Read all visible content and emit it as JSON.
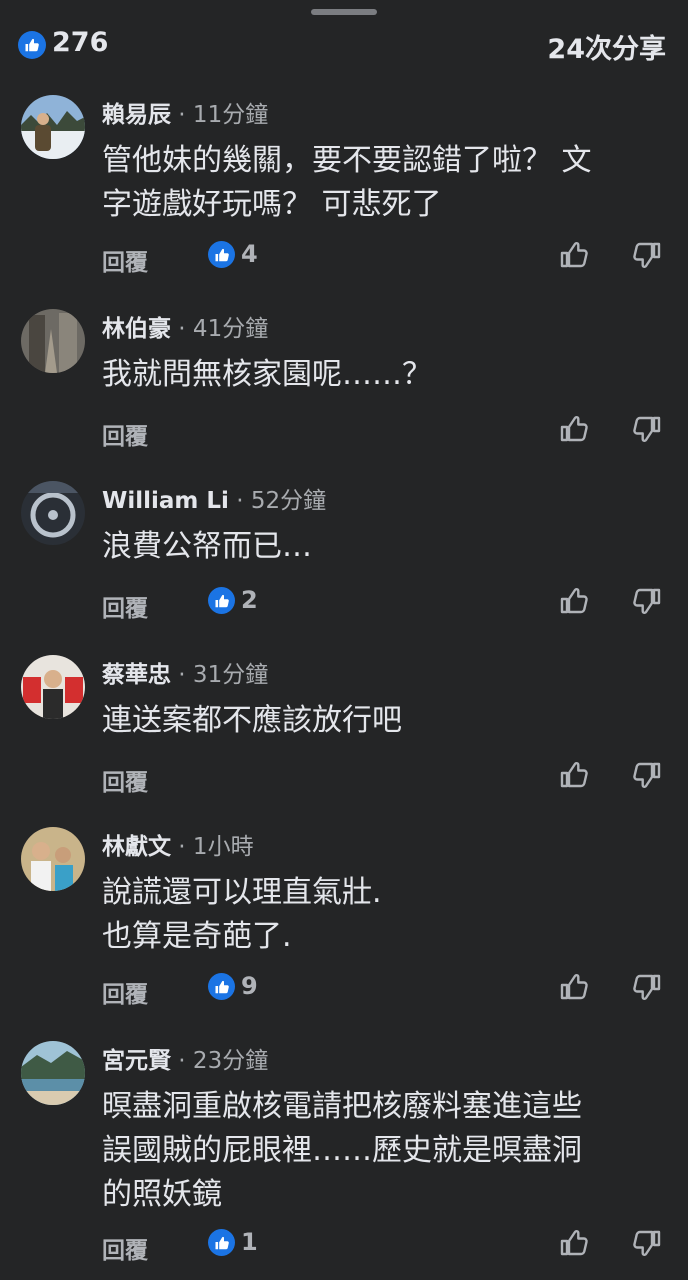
{
  "header": {
    "like_count": "276",
    "shares": "24次分享"
  },
  "reply_label": "回覆",
  "comments": [
    {
      "name": "賴易辰",
      "time": " · 11分鐘",
      "text": "管他妹的幾關，要不要認錯了啦？ 文\n字遊戲好玩嗎？ 可悲死了",
      "likes": "4"
    },
    {
      "name": "林伯豪",
      "time": " · 41分鐘",
      "text": "我就問無核家園呢……？",
      "likes": ""
    },
    {
      "name": "William Li",
      "time": " · 52分鐘",
      "text": "浪費公帑而已…",
      "likes": "2"
    },
    {
      "name": "蔡華忠",
      "time": " · 31分鐘",
      "text": "連送案都不應該放行吧",
      "likes": ""
    },
    {
      "name": "林獻文",
      "time": " · 1小時",
      "text": "說謊還可以理直氣壯.\n也算是奇葩了.",
      "likes": "9"
    },
    {
      "name": "宮元賢",
      "time": " · 23分鐘",
      "text": "暝盡洞重啟核電請把核廢料塞進這些\n誤國賊的屁眼裡……歷史就是暝盡洞\n的照妖鏡",
      "likes": "1"
    }
  ],
  "icons": {
    "like": "thumbs-up-icon",
    "vote_up": "thumbs-up-outline-icon",
    "vote_down": "thumbs-down-outline-icon"
  },
  "colors": {
    "background": "#242526",
    "like_blue": "#1b74e4",
    "text": "#e4e6eb",
    "muted": "#b0b3b8"
  }
}
